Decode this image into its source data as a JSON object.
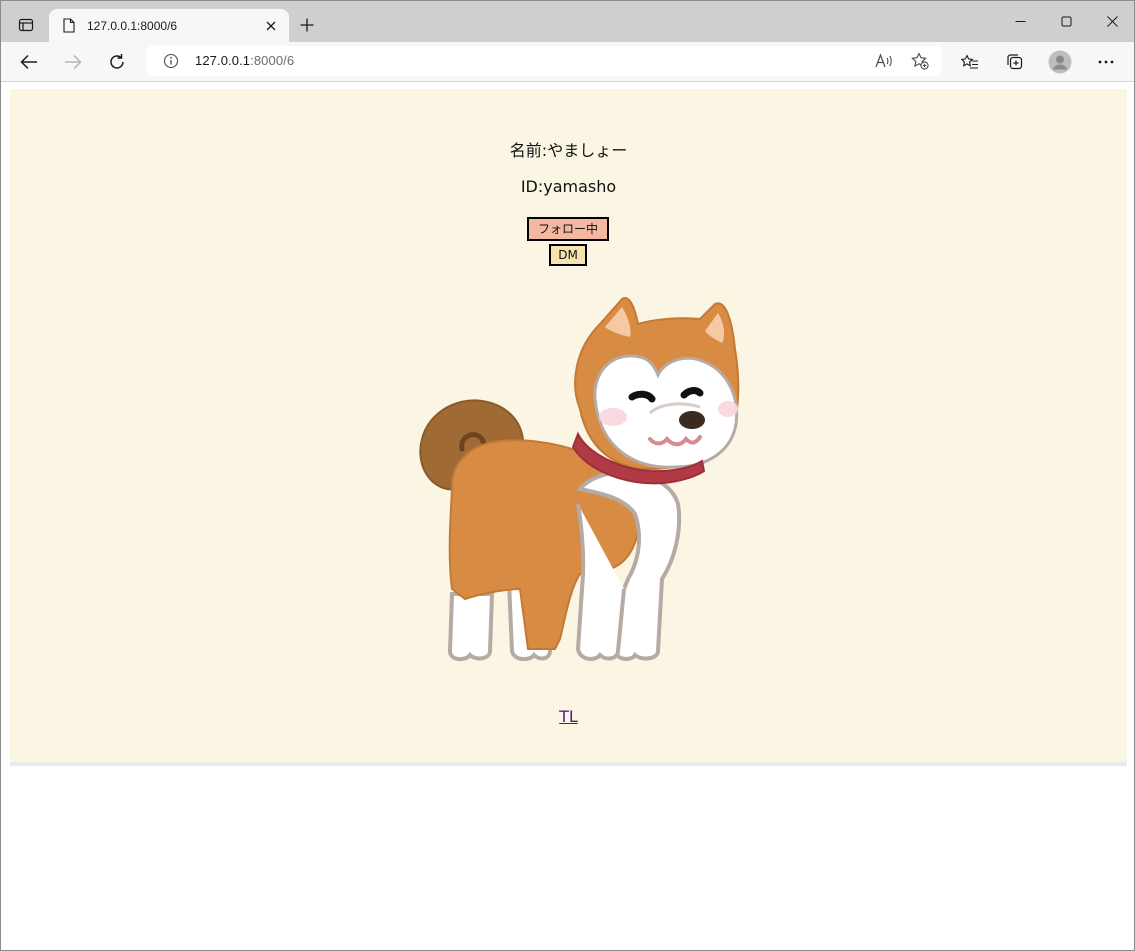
{
  "browser": {
    "tab_title": "127.0.0.1:8000/6",
    "url_host": "127.0.0.1",
    "url_path": ":8000/6"
  },
  "profile": {
    "name_text": "名前:やましょー",
    "id_text": "ID:yamasho",
    "follow_label": "フォロー中",
    "dm_label": "DM",
    "tl_link": "TL",
    "image_icon": "akita-dog-illustration"
  },
  "colors": {
    "page_bg": "#fbf5e3",
    "follow_bg": "#f4b8a2",
    "dm_bg": "#f6e3ae",
    "link": "#551a8b"
  }
}
